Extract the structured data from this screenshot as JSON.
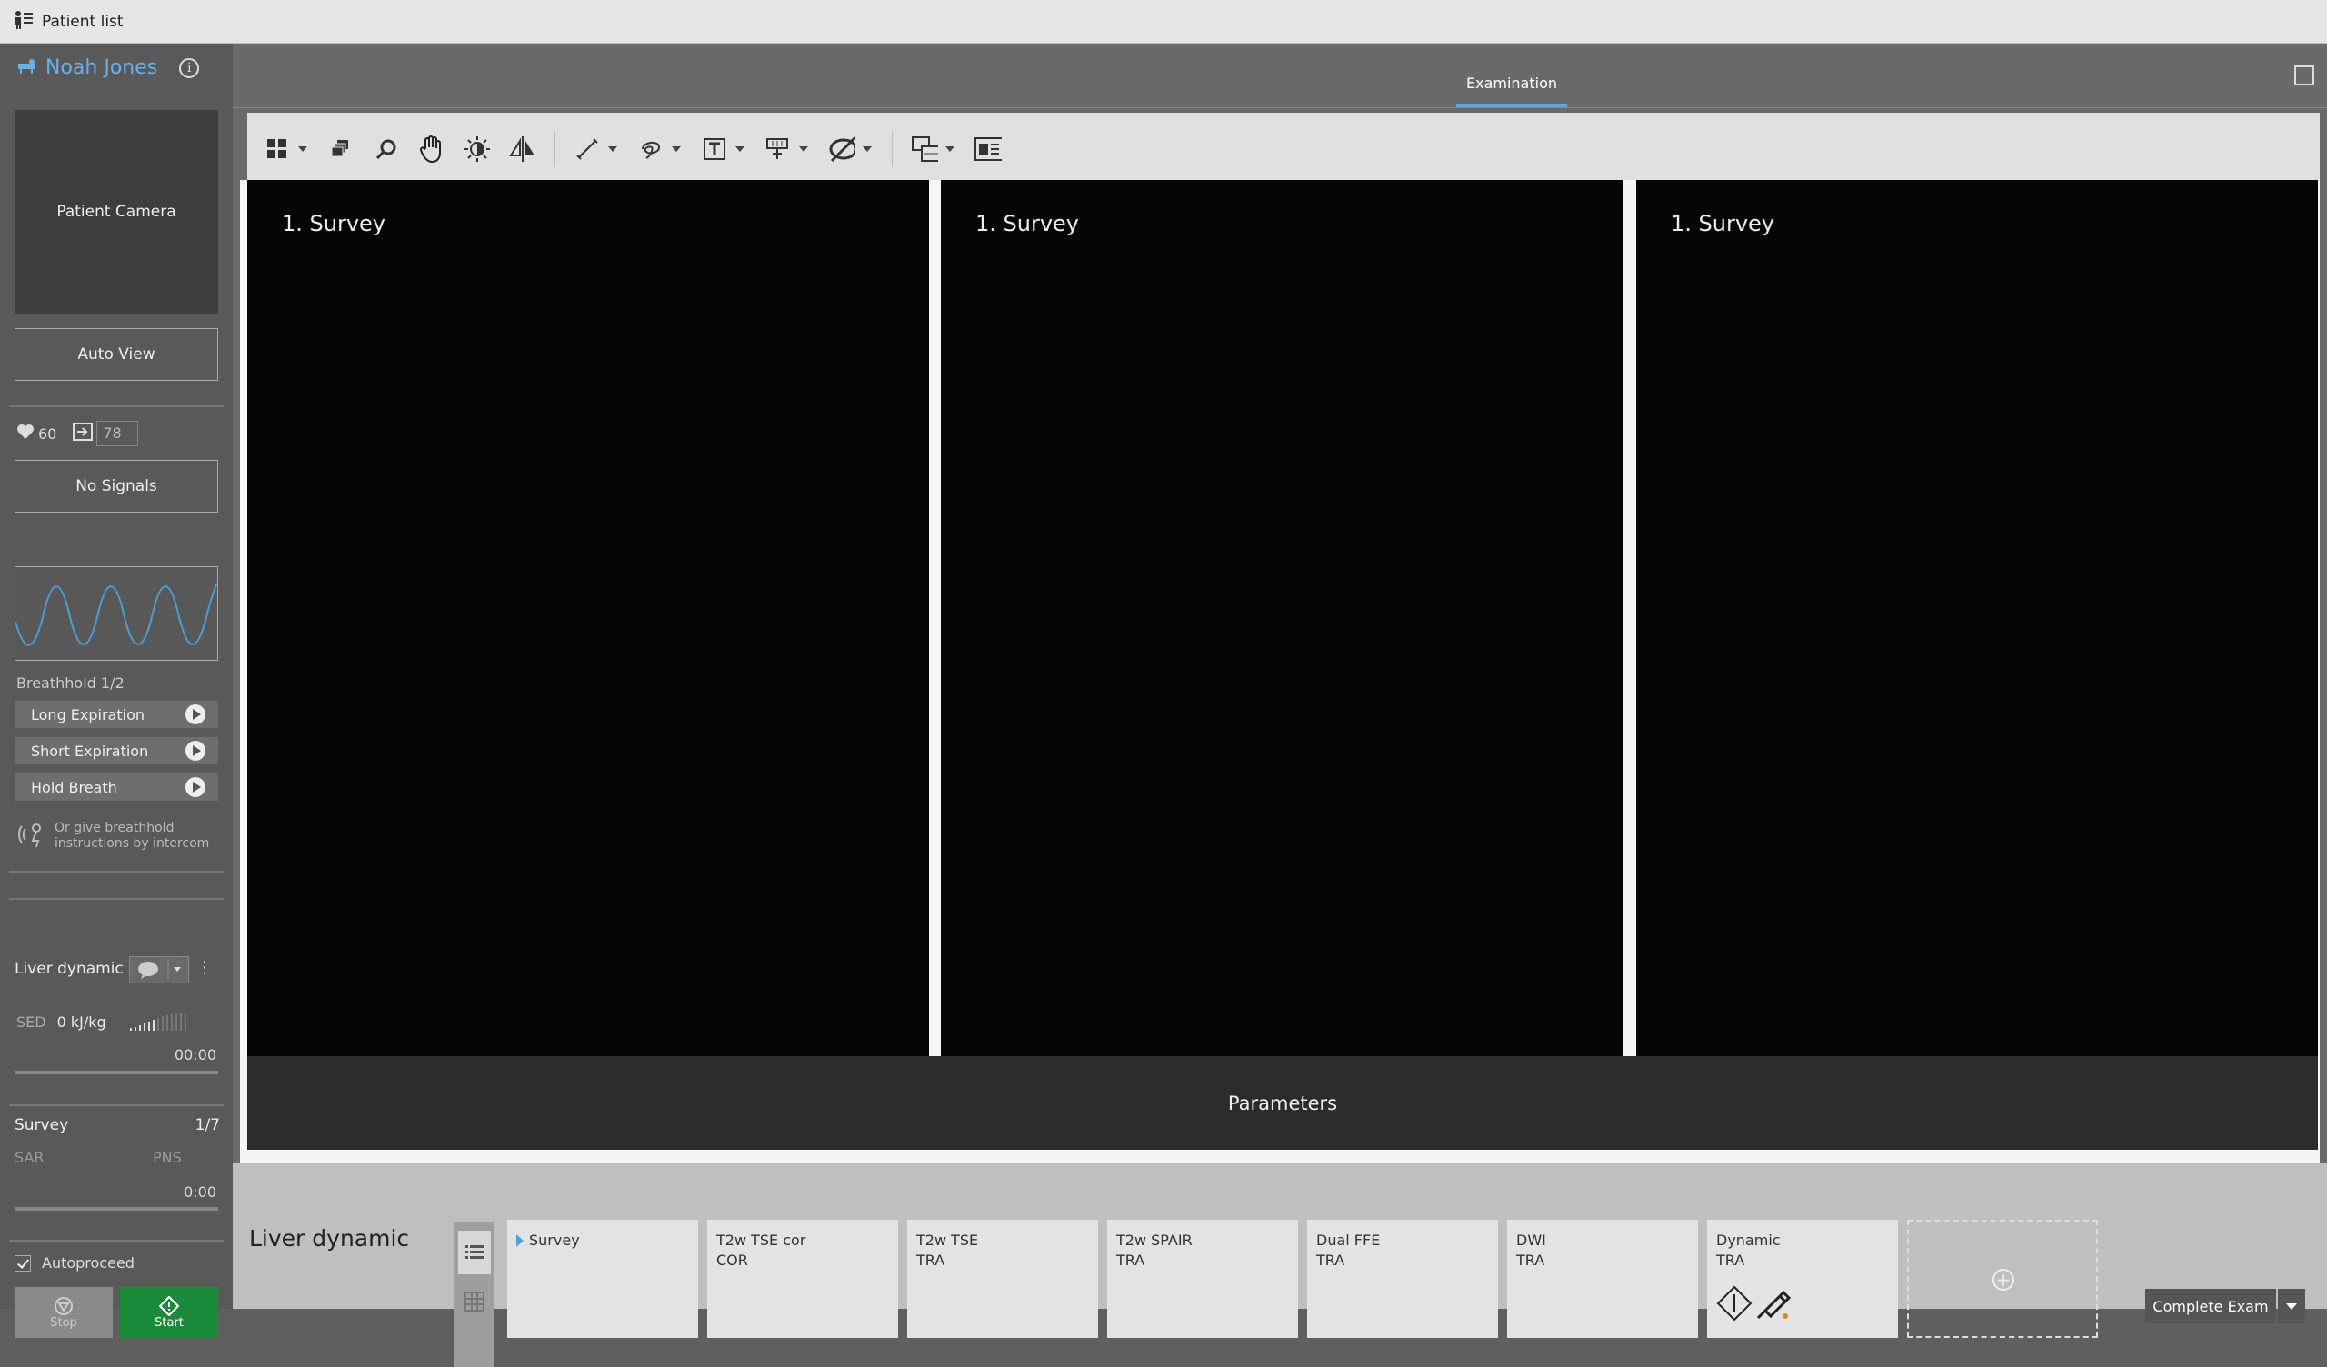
{
  "topbar": {
    "title": "Patient list"
  },
  "patient": {
    "name": "Noah Jones"
  },
  "left": {
    "camera_label": "Patient Camera",
    "auto_view": "Auto View",
    "heart_rate": "60",
    "resp_rate": "78",
    "no_signals": "No Signals",
    "breathhold_title": "Breathhold 1/2",
    "breathhold_items": [
      "Long Expiration",
      "Short Expiration",
      "Hold Breath"
    ],
    "intercom_line1": "Or give breathhold",
    "intercom_line2": "instructions by intercom",
    "exam_name": "Liver dynamic",
    "sed_label": "SED",
    "sed_value": "0 kJ/kg",
    "exam_time": "00:00",
    "scan_name": "Survey",
    "scan_count": "1/7",
    "sar_label": "SAR",
    "pns_label": "PNS",
    "scan_time": "0:00",
    "autoproceed": "Autoproceed",
    "stop": "Stop",
    "start": "Start"
  },
  "main": {
    "tab": "Examination",
    "viewports": [
      "1. Survey",
      "1. Survey",
      "1. Survey"
    ],
    "parameters": "Parameters"
  },
  "bottom": {
    "exam_title": "Liver dynamic",
    "cards": [
      {
        "line1": "Survey",
        "line2": ""
      },
      {
        "line1": "T2w TSE cor",
        "line2": "COR"
      },
      {
        "line1": "T2w TSE",
        "line2": "TRA"
      },
      {
        "line1": "T2w SPAIR",
        "line2": "TRA"
      },
      {
        "line1": "Dual FFE",
        "line2": "TRA"
      },
      {
        "line1": "DWI",
        "line2": "TRA"
      },
      {
        "line1": "Dynamic",
        "line2": "TRA"
      }
    ],
    "complete": "Complete Exam"
  },
  "colors": {
    "accent": "#5aa6e2",
    "start_green": "#1b8a3a",
    "wave": "#4aa0d8"
  }
}
